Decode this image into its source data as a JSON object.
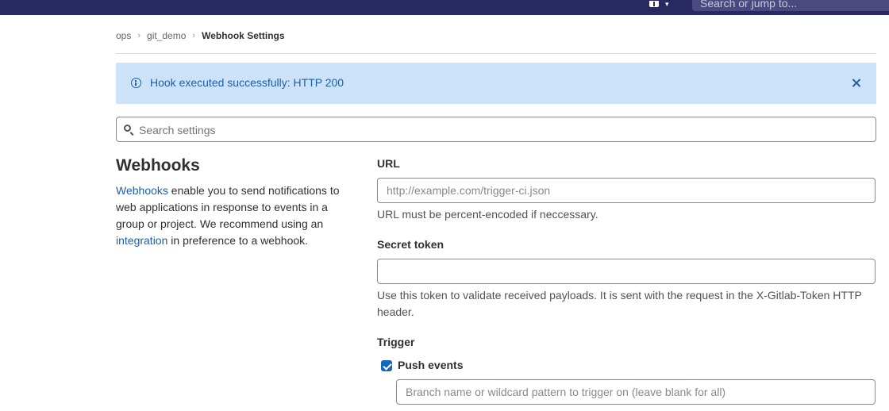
{
  "topbar": {
    "search_placeholder": "Search or jump to...",
    "new_menu_icon": "plus-square-icon",
    "new_menu_chevron": "chevron-down-icon"
  },
  "breadcrumb": {
    "items": [
      "ops",
      "git_demo",
      "Webhook Settings"
    ]
  },
  "alert": {
    "message": "Hook executed successfully: HTTP 200",
    "icon": "info-icon",
    "close_icon": "close-icon"
  },
  "settings_search": {
    "placeholder": "Search settings"
  },
  "webhooks": {
    "title": "Webhooks",
    "desc_link1": "Webhooks",
    "desc_part1": " enable you to send notifications to web applications in response to events in a group or project. We recommend using an ",
    "desc_link2": "integration",
    "desc_part2": " in preference to a webhook."
  },
  "form": {
    "url_label": "URL",
    "url_placeholder": "http://example.com/trigger-ci.json",
    "url_help": "URL must be percent-encoded if neccessary.",
    "secret_label": "Secret token",
    "secret_value": "",
    "secret_help": "Use this token to validate received payloads. It is sent with the request in the X-Gitlab-Token HTTP header.",
    "trigger_label": "Trigger",
    "push_events_label": "Push events",
    "push_events_checked": true,
    "branch_placeholder": "Branch name or wildcard pattern to trigger on (leave blank for all)"
  },
  "colors": {
    "topbar": "#292961",
    "alert_bg": "#cbe2f9",
    "link": "#1f5ea8",
    "checkbox": "#1068bf"
  }
}
